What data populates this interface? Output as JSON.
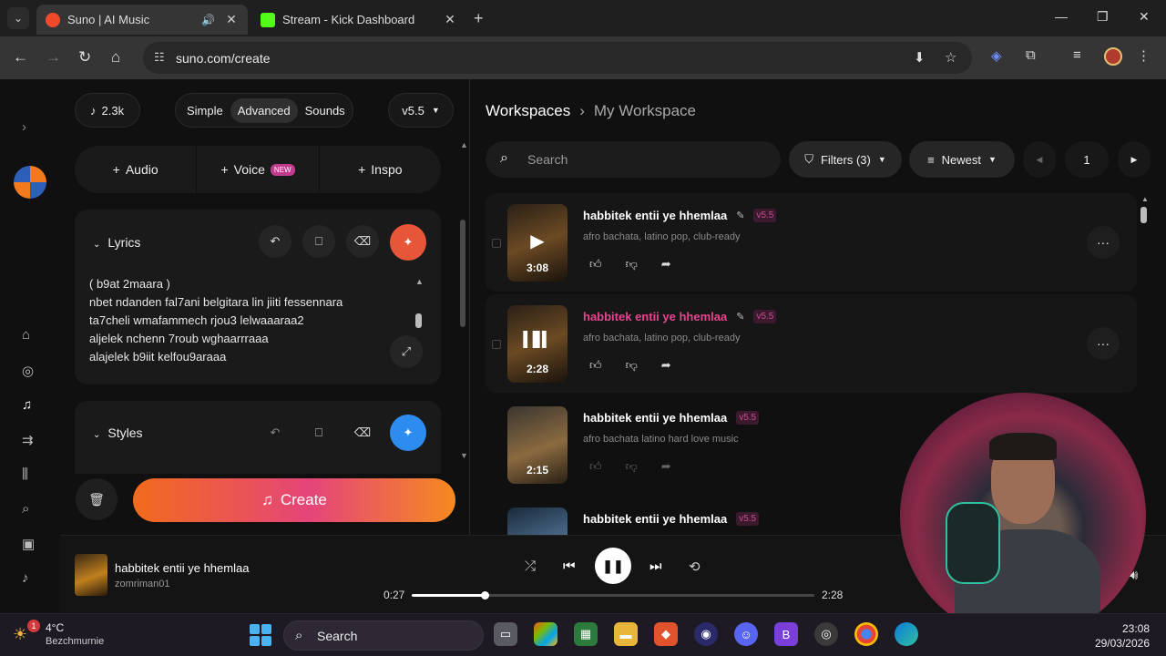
{
  "browser": {
    "tabs": [
      {
        "title": "Suno | AI Music",
        "active": true,
        "favicon_color": "#f04a2a"
      },
      {
        "title": "Stream - Kick Dashboard",
        "active": false,
        "favicon_color": "#53fc18"
      }
    ],
    "url": "suno.com/create"
  },
  "top_controls": {
    "credits": "2.3k",
    "modes": [
      "Simple",
      "Advanced",
      "Sounds"
    ],
    "active_mode": "Advanced",
    "version": "v5.5"
  },
  "add_bar": {
    "audio": "Audio",
    "voice": "Voice",
    "voice_badge": "NEW",
    "inspo": "Inspo"
  },
  "lyrics": {
    "header": "Lyrics",
    "lines": [
      "( b9at 2maara )",
      "nbet ndanden fal7ani belgitara lin jiiti fessennara",
      "ta7cheli wmafammech rjou3 lelwaaaraa2",
      "aljelek nchenn 7roub wghaarrraaa",
      "alajelek b9iit kelfou9araaa"
    ]
  },
  "styles": {
    "header": "Styles"
  },
  "create_label": "Create",
  "workspace": {
    "breadcrumb_root": "Workspaces",
    "breadcrumb_current": "My Workspace",
    "search_placeholder": "Search",
    "filters_label": "Filters (3)",
    "sort_label": "Newest",
    "page_number": "1"
  },
  "songs": [
    {
      "title": "habbitek entii ye hhemlaa",
      "version": "v5.5",
      "desc": "afro bachata, latino pop, club-ready",
      "duration": "3:08"
    },
    {
      "title": "habbitek entii ye hhemlaa",
      "version": "v5.5",
      "desc": "afro bachata, latino pop, club-ready",
      "duration": "2:28"
    },
    {
      "title": "habbitek entii ye hhemlaa",
      "version": "v5.5",
      "desc": "afro bachata latino hard love music",
      "duration": "2:15"
    },
    {
      "title": "habbitek entii ye hhemlaa",
      "version": "v5.5",
      "desc": "",
      "duration": ""
    }
  ],
  "player": {
    "title": "habbitek entii ye hhemlaa",
    "artist": "zomriman01",
    "elapsed": "0:27",
    "total": "2:28",
    "progress_fraction": 0.18
  },
  "taskbar": {
    "weather_badge": "1",
    "temperature": "4°C",
    "condition": "Bezchmurnie",
    "search_label": "Search",
    "time": "23:08",
    "date": "29/03/2026"
  },
  "colors": {
    "accent_pink": "#e5458e",
    "create_gradient_start": "#f26b1d",
    "create_gradient_mid": "#e5457a",
    "wand_red": "#e8563a",
    "wand_blue": "#2d8cf0"
  }
}
